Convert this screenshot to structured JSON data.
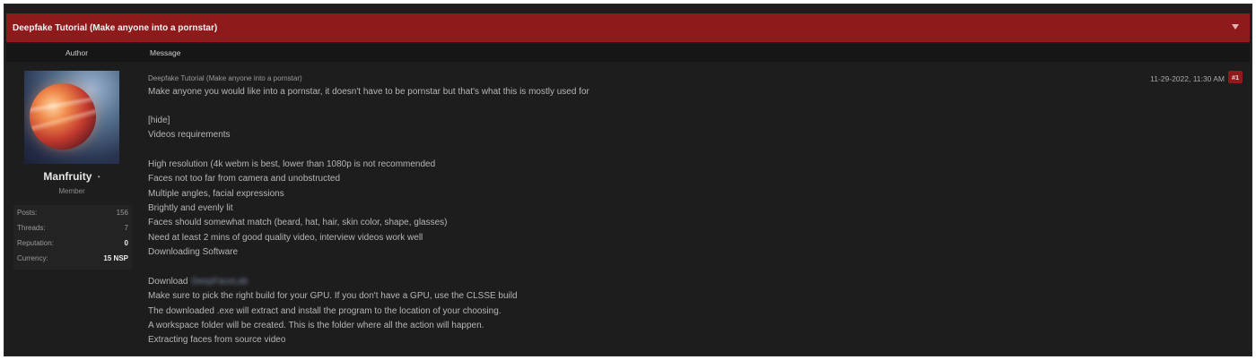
{
  "thread": {
    "title": "Deepfake Tutorial (Make anyone into a pornstar)",
    "columns": {
      "author": "Author",
      "message": "Message"
    }
  },
  "author": {
    "username": "Manfruity",
    "status_dot": "•",
    "role": "Member",
    "stats": [
      {
        "label": "Posts:",
        "value": "156"
      },
      {
        "label": "Threads:",
        "value": "7"
      },
      {
        "label": "Reputation:",
        "value": "0"
      },
      {
        "label": "Currency:",
        "value": "15 NSP"
      }
    ]
  },
  "post": {
    "subject": "Deepfake Tutorial (Make anyone into a pornstar)",
    "date": "11-29-2022, 11:30 AM",
    "number": "#1",
    "lines": [
      "Make anyone you would like into a pornstar, it doesn't have to be pornstar but that's what this is mostly used for",
      "",
      "[hide]",
      "Videos requirements",
      "",
      "High resolution (4k webm is best, lower than 1080p is not recommended",
      "Faces not too far from camera and unobstructed",
      "Multiple angles, facial expressions",
      "Brightly and evenly lit",
      "Faces should somewhat match (beard, hat, hair, skin color, shape, glasses)",
      "Need at least 2 mins of good quality video, interview videos work well",
      "Downloading Software",
      "",
      "Download",
      "Make sure to pick the right build for your GPU. If you don't have a GPU, use the CLSSE build",
      "The downloaded .exe will extract and install the program to the location of your choosing.",
      "A workspace folder will be created. This is the folder where all the action will happen.",
      "Extracting faces from source video"
    ],
    "download_link": "DeepFaceLab"
  },
  "colors": {
    "header_red": "#8e1a1c",
    "background": "#1d1d1d"
  },
  "icons": {
    "collapse": "chevron-down-icon"
  }
}
